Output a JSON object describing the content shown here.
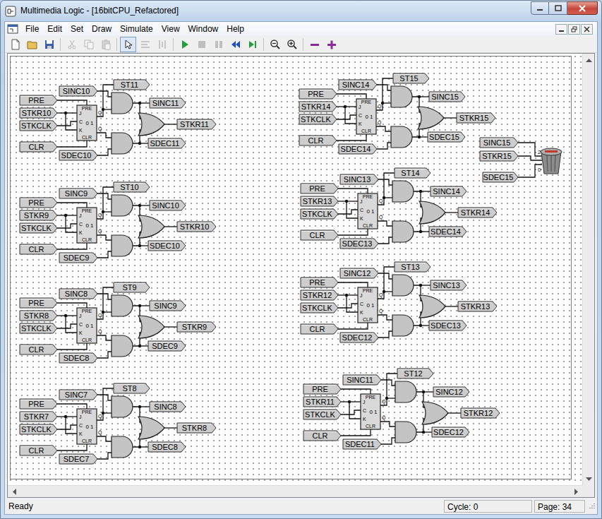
{
  "window": {
    "title": "Multimedia Logic - [16bitCPU_Refactored]"
  },
  "menu": [
    "File",
    "Edit",
    "Set",
    "Draw",
    "Simulate",
    "View",
    "Window",
    "Help"
  ],
  "toolbar": [
    {
      "disabled": false,
      "selected": false
    },
    {
      "disabled": false,
      "selected": false
    },
    {
      "disabled": false,
      "selected": false
    },
    {
      "disabled": true,
      "selected": false
    },
    {
      "disabled": true,
      "selected": false
    },
    {
      "disabled": true,
      "selected": false
    },
    {
      "disabled": false,
      "selected": true
    },
    {
      "disabled": true,
      "selected": false
    },
    {
      "disabled": true,
      "selected": false
    },
    {
      "disabled": false,
      "selected": false
    },
    {
      "disabled": true,
      "selected": false
    },
    {
      "disabled": true,
      "selected": false
    },
    {
      "disabled": false,
      "selected": false
    },
    {
      "disabled": false,
      "selected": false
    },
    {
      "disabled": false,
      "selected": false
    },
    {
      "disabled": false,
      "selected": false
    },
    {
      "disabled": false,
      "selected": false
    },
    {
      "disabled": false,
      "selected": false
    }
  ],
  "circuit": {
    "flipflop": {
      "preset": "PRE",
      "clear": "CLR",
      "j": "J",
      "clock": "C",
      "k": "K",
      "display": "0 1",
      "q": "Q",
      "qbar": "Q̄"
    },
    "cells": [
      {
        "pre": "PRE",
        "stkr_in": "STKR10",
        "clk": "STKCLK",
        "clr": "CLR",
        "sinc_in": "SINC10",
        "sdec_in": "SDEC10",
        "st_out": "ST11",
        "sinc_out": "SINC11",
        "stkr_out": "STKR11",
        "sdec_out": "SDEC11"
      },
      {
        "pre": "PRE",
        "stkr_in": "STKR9",
        "clk": "STKCLK",
        "clr": "CLR",
        "sinc_in": "SINC9",
        "sdec_in": "SDEC9",
        "st_out": "ST10",
        "sinc_out": "SINC10",
        "stkr_out": "STKR10",
        "sdec_out": "SDEC10"
      },
      {
        "pre": "PRE",
        "stkr_in": "STKR8",
        "clk": "STKCLK",
        "clr": "CLR",
        "sinc_in": "SINC8",
        "sdec_in": "SDEC8",
        "st_out": "ST9",
        "sinc_out": "SINC9",
        "stkr_out": "STKR9",
        "sdec_out": "SDEC9"
      },
      {
        "pre": "PRE",
        "stkr_in": "STKR7",
        "clk": "STKCLK",
        "clr": "CLR",
        "sinc_in": "SINC7",
        "sdec_in": "SDEC7",
        "st_out": "ST8",
        "sinc_out": "SINC8",
        "stkr_out": "STKR8",
        "sdec_out": "SDEC8"
      },
      {
        "pre": "PRE",
        "stkr_in": "STKR14",
        "clk": "STKCLK",
        "clr": "CLR",
        "sinc_in": "SINC14",
        "sdec_in": "SDEC14",
        "st_out": "ST15",
        "sinc_out": "SINC15",
        "stkr_out": "STKR15",
        "sdec_out": "SDEC15"
      },
      {
        "pre": "PRE",
        "stkr_in": "STKR13",
        "clk": "STKCLK",
        "clr": "CLR",
        "sinc_in": "SINC13",
        "sdec_in": "SDEC13",
        "st_out": "ST14",
        "sinc_out": "SINC14",
        "stkr_out": "STKR14",
        "sdec_out": "SDEC14"
      },
      {
        "pre": "PRE",
        "stkr_in": "STKR12",
        "clk": "STKCLK",
        "clr": "CLR",
        "sinc_in": "SINC12",
        "sdec_in": "SDEC12",
        "st_out": "ST13",
        "sinc_out": "SINC13",
        "stkr_out": "STKR13",
        "sdec_out": "SDEC13"
      },
      {
        "pre": "PRE",
        "stkr_in": "STKR11",
        "clk": "STKCLK",
        "clr": "CLR",
        "sinc_in": "SINC11",
        "sdec_in": "SDEC11",
        "st_out": "ST12",
        "sinc_out": "SINC12",
        "stkr_out": "STKR12",
        "sdec_out": "SDEC12"
      }
    ],
    "bin": {
      "inputs": [
        "SINC15",
        "STKR15",
        "SDEC15"
      ],
      "pins": [
        "2",
        "0"
      ]
    }
  },
  "status_bar": {
    "message": "Ready",
    "cycle": "Cycle: 0",
    "page": "Page: 34"
  }
}
